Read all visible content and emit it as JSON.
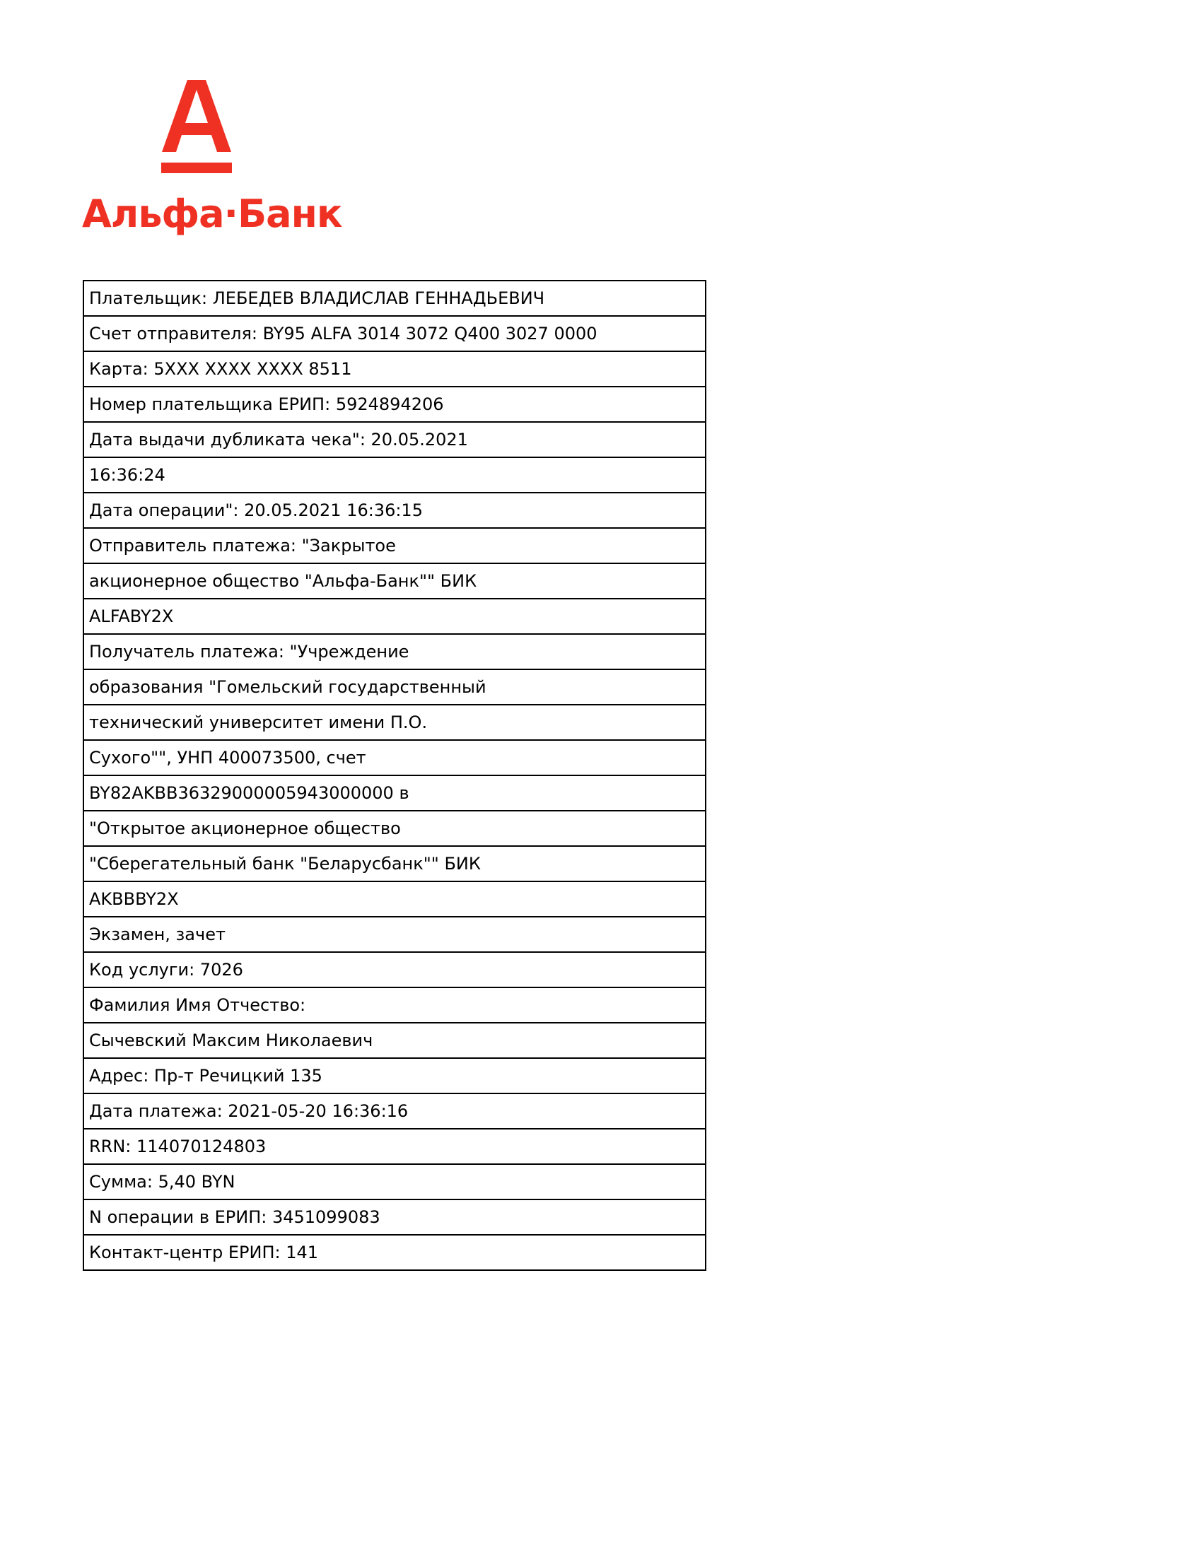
{
  "bank": {
    "name": "Альфа·Банк",
    "brand_color": "#ef3124",
    "logo_icon": "alfa-letter-a-icon"
  },
  "receipt_lines": [
    "Плательщик: ЛЕБЕДЕВ ВЛАДИСЛАВ ГЕННАДЬЕВИЧ",
    "Счет отправителя: BY95 ALFA 3014 3072 Q400 3027 0000",
    "Карта: 5XXX XXXX XXXX 8511",
    "Номер плательщика ЕРИП: 5924894206",
    "Дата выдачи дубликата чека\": 20.05.2021",
    "16:36:24",
    "Дата операции\": 20.05.2021 16:36:15",
    "Отправитель платежа: \"Закрытое",
    "акционерное общество \"Альфа-Банк\"\" БИК",
    "ALFABY2X",
    "Получатель платежа: \"Учреждение",
    "образования \"Гомельский государственный",
    "технический университет имени П.О.",
    "Сухого\"\", УНП 400073500, счет",
    "BY82AKBB36329000005943000000 в",
    "\"Открытое акционерное общество",
    "\"Сберегательный банк \"Беларусбанк\"\" БИК",
    "AKBBBY2X",
    "Экзамен, зачет",
    "Код услуги: 7026",
    "Фамилия Имя Отчество:",
    "Сычевский Максим Николаевич",
    "Адрес: Пр-т Речицкий 135",
    "Дата платежа: 2021-05-20 16:36:16",
    "RRN: 114070124803",
    "Сумма: 5,40 BYN",
    "N операции в ЕРИП: 3451099083",
    "Контакт-центр ЕРИП: 141"
  ]
}
